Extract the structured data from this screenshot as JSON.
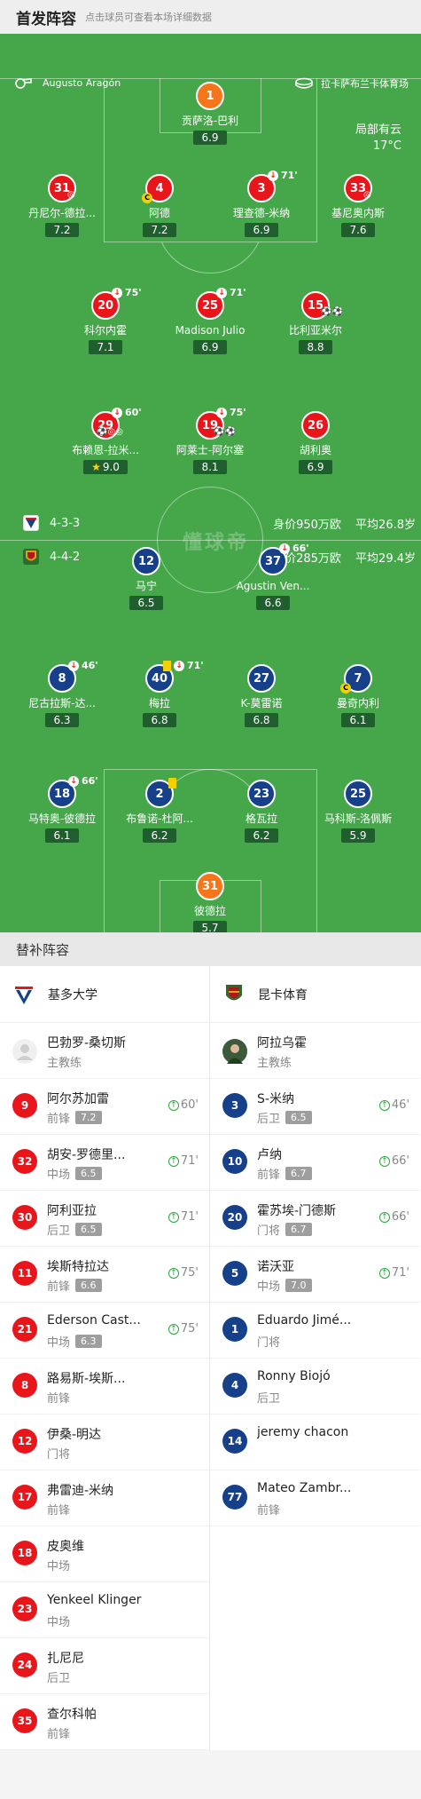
{
  "header": {
    "title": "首发阵容",
    "subtitle": "点击球员可查看本场详细数据"
  },
  "match": {
    "referee": "Augusto Aragón",
    "venue": "拉卡萨布兰卡体育场",
    "weather": "局部有云",
    "temperature": "17°C"
  },
  "home_team": {
    "formation": "4-3-3",
    "value": "身价950万欧",
    "avg_age": "平均26.8岁"
  },
  "away_team": {
    "formation": "4-4-2",
    "value": "身价285万欧",
    "avg_age": "平均29.4岁"
  },
  "watermark": "懂球帝",
  "colors": {
    "home": "#e8161b",
    "away": "#16408a",
    "gk": "#f5761a",
    "pitch": "#45a74a"
  },
  "home_players": [
    {
      "num": "1",
      "name": "贡萨洛-巴利",
      "rating": "6.9"
    },
    {
      "num": "31",
      "name": "丹尼尔-德拉...",
      "rating": "7.2"
    },
    {
      "num": "4",
      "name": "阿德",
      "rating": "7.2"
    },
    {
      "num": "3",
      "name": "理查德-米纳",
      "rating": "6.9",
      "sub": "71'"
    },
    {
      "num": "33",
      "name": "基尼奥内斯",
      "rating": "7.6"
    },
    {
      "num": "20",
      "name": "科尔内霍",
      "rating": "7.1",
      "sub": "75'"
    },
    {
      "num": "25",
      "name": "Madison Julio",
      "rating": "6.9",
      "sub": "71'"
    },
    {
      "num": "15",
      "name": "比利亚米尔",
      "rating": "8.8"
    },
    {
      "num": "29",
      "name": "布赖恩-拉米...",
      "rating": "9.0",
      "sub": "60'"
    },
    {
      "num": "19",
      "name": "阿莱士-阿尔塞",
      "rating": "8.1",
      "sub": "75'"
    },
    {
      "num": "26",
      "name": "胡利奥",
      "rating": "6.9"
    }
  ],
  "away_players": [
    {
      "num": "12",
      "name": "马宁",
      "rating": "6.5"
    },
    {
      "num": "37",
      "name": "Agustin Ven...",
      "rating": "6.6",
      "sub": "66'"
    },
    {
      "num": "8",
      "name": "尼古拉斯-达...",
      "rating": "6.3",
      "sub": "46'"
    },
    {
      "num": "40",
      "name": "梅拉",
      "rating": "6.8",
      "sub": "71'"
    },
    {
      "num": "27",
      "name": "K-莫雷诺",
      "rating": "6.8"
    },
    {
      "num": "7",
      "name": "曼奇内利",
      "rating": "6.1"
    },
    {
      "num": "18",
      "name": "马特奥-彼德拉",
      "rating": "6.1",
      "sub": "66'"
    },
    {
      "num": "2",
      "name": "布鲁诺-杜阿...",
      "rating": "6.2"
    },
    {
      "num": "23",
      "name": "格瓦拉",
      "rating": "6.2"
    },
    {
      "num": "25",
      "name": "马科斯-洛佩斯",
      "rating": "5.9"
    },
    {
      "num": "31",
      "name": "彼德拉",
      "rating": "5.7"
    }
  ],
  "subs_section": {
    "title": "替补阵容"
  },
  "bench_home": {
    "team": "基多大学",
    "coach": {
      "name": "巴勃罗-桑切斯",
      "role": "主教练"
    },
    "players": [
      {
        "num": "9",
        "name": "阿尔苏加雷",
        "pos": "前锋",
        "rating": "7.2",
        "minute": "60'"
      },
      {
        "num": "32",
        "name": "胡安-罗德里...",
        "pos": "中场",
        "rating": "6.5",
        "minute": "71'"
      },
      {
        "num": "30",
        "name": "阿利亚拉",
        "pos": "后卫",
        "rating": "6.5",
        "minute": "71'"
      },
      {
        "num": "11",
        "name": "埃斯特拉达",
        "pos": "前锋",
        "rating": "6.6",
        "minute": "75'"
      },
      {
        "num": "21",
        "name": "Ederson Cast...",
        "pos": "中场",
        "rating": "6.3",
        "minute": "75'"
      },
      {
        "num": "8",
        "name": "路易斯-埃斯...",
        "pos": "前锋"
      },
      {
        "num": "12",
        "name": "伊桑-明达",
        "pos": "门将"
      },
      {
        "num": "17",
        "name": "弗雷迪-米纳",
        "pos": "前锋"
      },
      {
        "num": "18",
        "name": "皮奥维",
        "pos": "中场"
      },
      {
        "num": "23",
        "name": "Yenkeel Klinger",
        "pos": "中场"
      },
      {
        "num": "24",
        "name": "扎尼尼",
        "pos": "后卫"
      },
      {
        "num": "35",
        "name": "查尔科帕",
        "pos": "前锋"
      }
    ]
  },
  "bench_away": {
    "team": "昆卡体育",
    "coach": {
      "name": "阿拉乌霍",
      "role": "主教练"
    },
    "players": [
      {
        "num": "3",
        "name": "S-米纳",
        "pos": "后卫",
        "rating": "6.5",
        "minute": "46'"
      },
      {
        "num": "10",
        "name": "卢纳",
        "pos": "前锋",
        "rating": "6.7",
        "minute": "66'"
      },
      {
        "num": "20",
        "name": "霍苏埃-门德斯",
        "pos": "门将",
        "rating": "6.7",
        "minute": "66'"
      },
      {
        "num": "5",
        "name": "诺沃亚",
        "pos": "中场",
        "rating": "7.0",
        "minute": "71'"
      },
      {
        "num": "1",
        "name": "Eduardo Jimé...",
        "pos": "门将"
      },
      {
        "num": "4",
        "name": "Ronny Biojó",
        "pos": "后卫"
      },
      {
        "num": "14",
        "name": "jeremy chacon",
        "pos": ""
      },
      {
        "num": "77",
        "name": "Mateo Zambr...",
        "pos": "前锋"
      }
    ]
  }
}
